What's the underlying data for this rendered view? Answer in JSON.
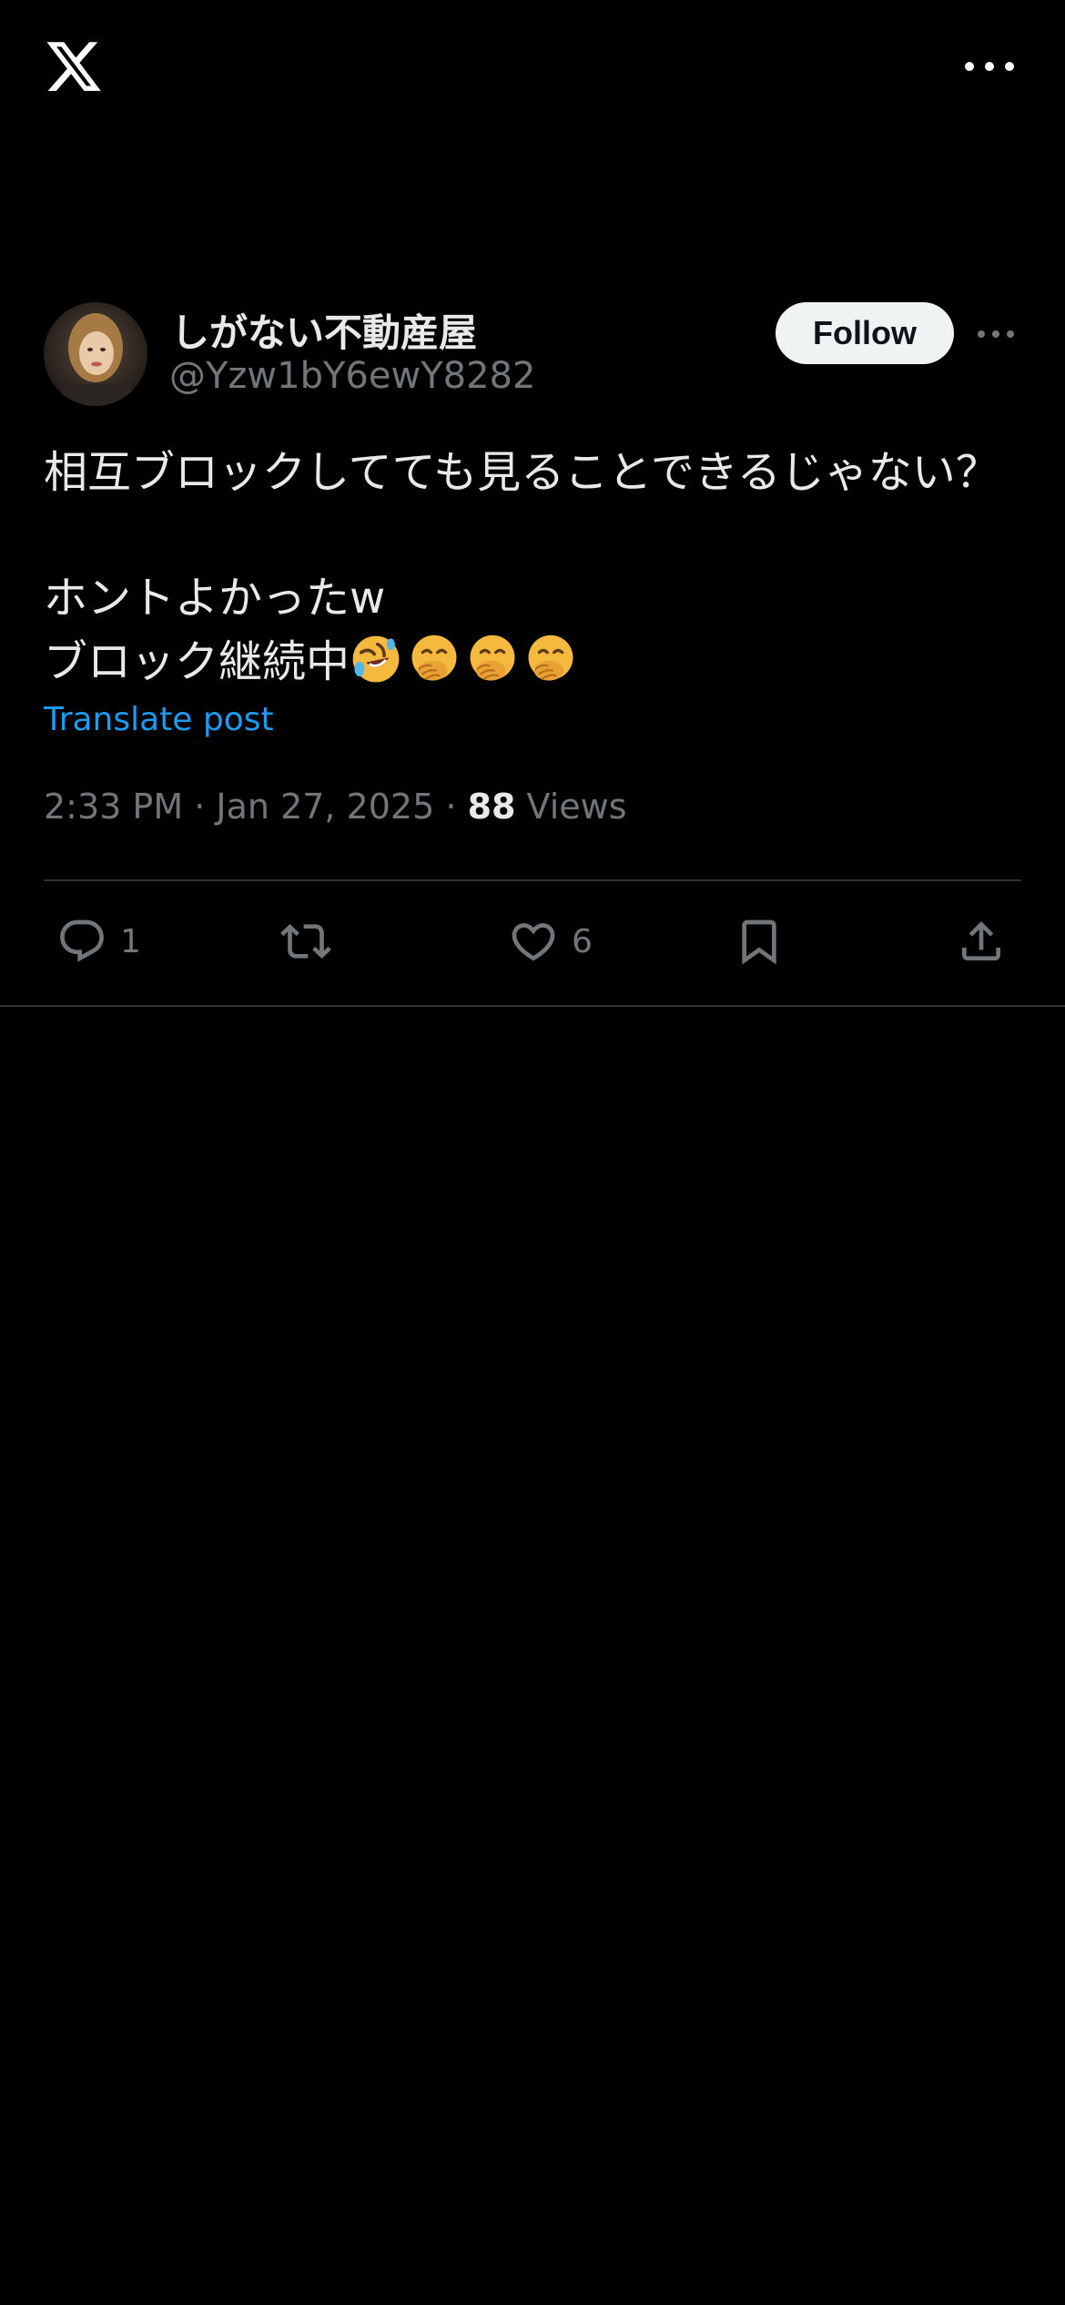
{
  "header": {
    "logo_icon": "x-logo-icon",
    "more_icon": "more-horizontal-icon"
  },
  "author": {
    "display_name": "しがない不動産屋",
    "handle": "@Yzw1bY6ewY8282",
    "follow_label": "Follow",
    "more_icon": "more-horizontal-icon"
  },
  "post": {
    "line1": "相互ブロックしてても見ることできるじゃない？",
    "line2": "ホントよかったw",
    "line3": "ブロック継続中",
    "emojis": [
      "rolling-on-floor-laughing-emoji",
      "face-with-hand-over-mouth-emoji",
      "face-with-hand-over-mouth-emoji",
      "face-with-hand-over-mouth-emoji"
    ],
    "translate_label": "Translate post"
  },
  "meta": {
    "time": "2:33 PM",
    "separator": "·",
    "date": "Jan 27, 2025",
    "views_count": "88",
    "views_label": "Views"
  },
  "actions": {
    "reply_count": "1",
    "like_count": "6"
  },
  "colors": {
    "background": "#000000",
    "text_primary": "#e7e9ea",
    "text_secondary": "#71767b",
    "link": "#1d9bf0",
    "divider": "#2f3336",
    "follow_bg": "#eff3f4"
  }
}
